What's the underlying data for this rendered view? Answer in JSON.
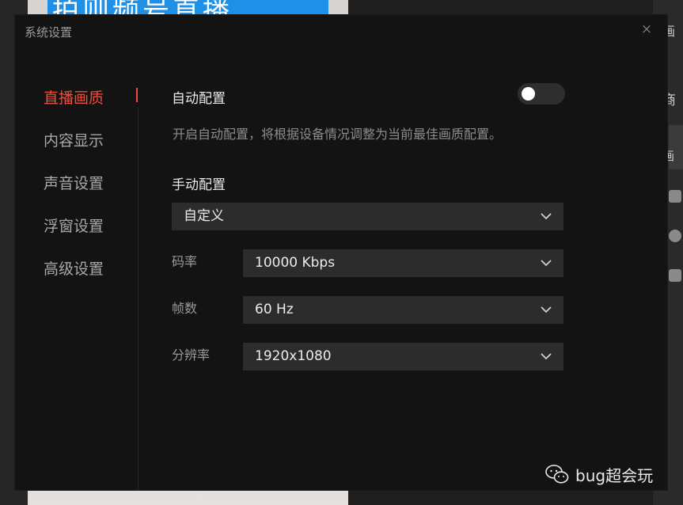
{
  "background": {
    "banner_text": "拍则频号直播",
    "right_panel": {
      "item_top": "画",
      "item_mid": "商",
      "item_low": "画"
    }
  },
  "dialog": {
    "title": "系统设置",
    "close_glyph": "×"
  },
  "nav": {
    "items": [
      {
        "label": "直播画质",
        "active": true
      },
      {
        "label": "内容显示",
        "active": false
      },
      {
        "label": "声音设置",
        "active": false
      },
      {
        "label": "浮窗设置",
        "active": false
      },
      {
        "label": "高级设置",
        "active": false
      }
    ]
  },
  "content": {
    "auto_config": {
      "label": "自动配置",
      "enabled": false,
      "description": "开启自动配置，将根据设备情况调整为当前最佳画质配置。"
    },
    "manual_config": {
      "label": "手动配置",
      "preset": "自定义"
    },
    "fields": [
      {
        "label": "码率",
        "value": "10000 Kbps"
      },
      {
        "label": "帧数",
        "value": "60 Hz"
      },
      {
        "label": "分辨率",
        "value": "1920x1080"
      }
    ]
  },
  "watermark": {
    "text": "bug超会玩",
    "icon": "wechat-icon"
  },
  "colors": {
    "accent": "#f04b3c",
    "dialog_bg": "#131313",
    "select_bg": "#2c2c2c"
  }
}
